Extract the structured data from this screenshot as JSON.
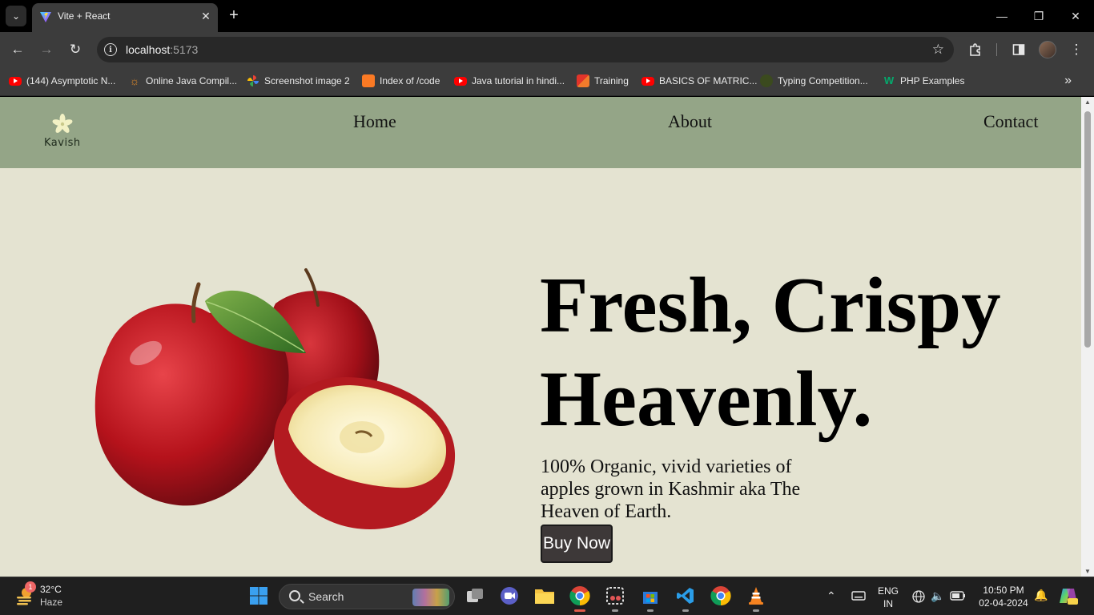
{
  "browser": {
    "tab": {
      "title": "Vite + React"
    },
    "address": {
      "host": "localhost",
      "port": ":5173"
    },
    "bookmarks": [
      {
        "label": "(144) Asymptotic N...",
        "icon": "youtube-icon"
      },
      {
        "label": "Online Java Compil...",
        "icon": "sun-icon"
      },
      {
        "label": "Screenshot image 2",
        "icon": "pinwheel-icon"
      },
      {
        "label": "Index of /code",
        "icon": "xampp-icon"
      },
      {
        "label": "Java tutorial in hindi...",
        "icon": "youtube-icon"
      },
      {
        "label": "Training",
        "icon": "training-icon"
      },
      {
        "label": "BASICS OF MATRIC...",
        "icon": "youtube-icon"
      },
      {
        "label": "Typing Competition...",
        "icon": "typing-icon"
      },
      {
        "label": "PHP Examples",
        "icon": "w3-icon"
      }
    ]
  },
  "page": {
    "logo_text": "Kavish",
    "nav": [
      {
        "label": "Home"
      },
      {
        "label": "About"
      },
      {
        "label": "Contact"
      }
    ],
    "hero": {
      "title": "Fresh, Crispy Heavenly.",
      "subtitle": "100% Organic, vivid varieties of apples grown in Kashmir aka The Heaven of Earth.",
      "button_label": "Buy Now"
    },
    "colors": {
      "background": "#e4e3d1",
      "navbar": "#94a587",
      "button": "#3d3838"
    }
  },
  "taskbar": {
    "weather": {
      "badge": "1",
      "temp": "32°C",
      "condition": "Haze"
    },
    "search_label": "Search",
    "language": {
      "line1": "ENG",
      "line2": "IN"
    },
    "clock": {
      "time": "10:50 PM",
      "date": "02-04-2024"
    }
  }
}
